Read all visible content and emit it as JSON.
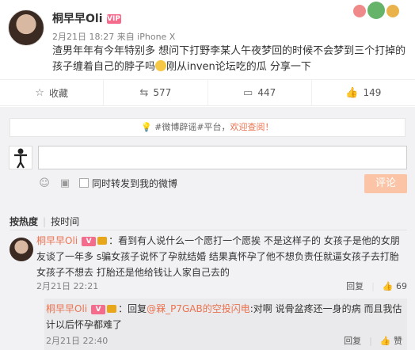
{
  "post": {
    "author": "桐早早Oli",
    "vip_badge": "VIP",
    "meta": "2月21日 18:27 来自 iPhone X",
    "text_line1": "渣男年年有今年特别多 想问下打野李某人午夜梦回的时候不会梦到三个打掉的孩子缠着自己的脖子吗",
    "text_line2": "刚从inven论坛吃的瓜 分享一下"
  },
  "actions": {
    "favorite": "收藏",
    "repost": "577",
    "comment": "447",
    "like": "149"
  },
  "notice": {
    "tag": "#微博辟谣#平台，",
    "highlight": "欢迎查阅！"
  },
  "composer": {
    "repost_label": "同时转发到我的微博",
    "submit_label": "评论"
  },
  "sort": {
    "hot": "按热度",
    "time": "按时间"
  },
  "comment": {
    "user": "桐早早Oli",
    "text": "：看到有人说什么一个愿打一个愿挨 不是这样子的 女孩子是他的女朋友谈了一年多 s骗女孩子说怀了孕就结婚 结果真怀孕了他不想负责任就逼女孩子去打胎 女孩子不想去 打胎还是他给钱让人家自己去的",
    "time": "2月21日 22:21",
    "reply_label": "回复",
    "likes": "69"
  },
  "sub_comment": {
    "user": "桐早早Oli",
    "prefix": "：回复",
    "mention": "@槑_P7GAB的空投闪电",
    "text": ":对啊 说骨盆疼还一身的病 而且我估计以后怀孕都难了",
    "time": "2月21日 22:40",
    "reply_label": "回复",
    "like_label": "赞"
  }
}
